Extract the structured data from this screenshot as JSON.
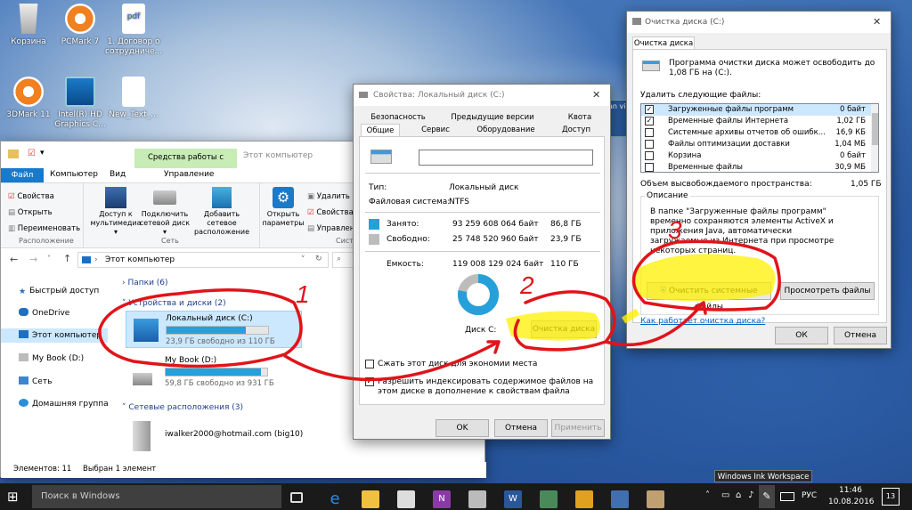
{
  "desktop": {
    "icons": [
      {
        "label": "Корзина"
      },
      {
        "label": "PCMark 7"
      },
      {
        "label": "1. Договор о сотрудниче..."
      },
      {
        "label": "3DMark 11"
      },
      {
        "label": "Intel(R) HD Graphics C..."
      },
      {
        "label": "New_Text_..."
      }
    ]
  },
  "explorer": {
    "title": "Этот компьютер",
    "ribbon_context": "Средства работы с дисками",
    "tabs": [
      "Файл",
      "Компьютер",
      "Вид",
      "Управление"
    ],
    "group_location": {
      "items": [
        "Свойства",
        "Открыть",
        "Переименовать"
      ],
      "label": "Расположение"
    },
    "group_network": {
      "items": [
        "Доступ к мультимедиа ▾",
        "Подключить сетевой диск ▾",
        "Добавить сетевое расположение"
      ],
      "label": "Сеть"
    },
    "group_system": {
      "items": [
        "Открыть параметры",
        "Удалить и",
        "Свойства с",
        "Управлен"
      ],
      "label": "Систе"
    },
    "address": "Этот компьютер",
    "nav": [
      "Быстрый доступ",
      "OneDrive",
      "Этот компьютер",
      "My Book (D:)",
      "Сеть",
      "Домашняя группа"
    ],
    "section_folders": "Папки (6)",
    "section_drives": "Устройства и диски (2)",
    "drive_c": {
      "name": "Локальный диск (C:)",
      "free": "23,9 ГБ свободно из 110 ГБ",
      "used_fraction": 0.78
    },
    "drive_d": {
      "name": "My Book (D:)",
      "free": "59,8 ГБ свободно из 931 ГБ",
      "used_fraction": 0.94
    },
    "section_network": "Сетевые расположения (3)",
    "network_item": "iwalker2000@hotmail.com (big10)",
    "status_items": "Элементов: 11",
    "status_selected": "Выбран 1 элемент"
  },
  "props": {
    "title": "Свойства: Локальный диск (C:)",
    "tabs_row1": [
      "Безопасность",
      "Предыдущие версии",
      "Квота"
    ],
    "tabs_row2": [
      "Общие",
      "Сервис",
      "Оборудование",
      "Доступ"
    ],
    "type_label": "Тип:",
    "type_value": "Локальный диск",
    "fs_label": "Файловая система:",
    "fs_value": "NTFS",
    "used_label": "Занято:",
    "used_bytes": "93 259 608 064 байт",
    "used_gb": "86,8 ГБ",
    "free_label": "Свободно:",
    "free_bytes": "25 748 520 960 байт",
    "free_gb": "23,9 ГБ",
    "cap_label": "Емкость:",
    "cap_bytes": "119 008 129 024 байт",
    "cap_gb": "110 ГБ",
    "disk_label": "Диск C:",
    "cleanup_button": "Очистка диска",
    "compress_label": "Сжать этот диск для экономии места",
    "index_label": "Разрешить индексировать содержимое файлов на этом диске в дополнение к свойствам файла",
    "ok": "OK",
    "cancel": "Отмена",
    "apply": "Применить",
    "used_color": "#26a0da",
    "free_color": "#bcbcbc",
    "used_fraction": 0.784
  },
  "cleanup": {
    "title": "Очистка диска  (C:)",
    "tab": "Очистка диска",
    "intro": "Программа очистки диска может освободить до 1,08 ГБ на  (C:).",
    "list_label": "Удалить следующие файлы:",
    "files": [
      {
        "name": "Загруженные файлы программ",
        "size": "0 байт",
        "checked": true
      },
      {
        "name": "Временные файлы Интернета",
        "size": "1,02 ГБ",
        "checked": true
      },
      {
        "name": "Системные архивы отчетов об ошибк...",
        "size": "16,9 КБ",
        "checked": false
      },
      {
        "name": "Файлы оптимизации доставки",
        "size": "1,04 МБ",
        "checked": false
      },
      {
        "name": "Корзина",
        "size": "0 байт",
        "checked": false
      },
      {
        "name": "Временные файлы",
        "size": "30,9 МБ",
        "checked": false
      }
    ],
    "total_label": "Объем высвобождаемого пространства:",
    "total_value": "1,05 ГБ",
    "desc_label": "Описание",
    "desc_text": "В папке \"Загруженные файлы программ\" временно сохраняются элементы ActiveX и приложения Java, автоматически загружаемые из Интернета при просмотре некоторых страниц.",
    "sys_button": "Очистить системные файлы",
    "view_button": "Просмотреть файлы",
    "link": "Как работает очистка диска?",
    "ok": "ОК",
    "cancel": "Отмена"
  },
  "annotations": [
    "1",
    "2",
    "3"
  ],
  "ink_tooltip": "Windows Ink Workspace",
  "taskbar": {
    "search": "Поиск в Windows",
    "lang": "РУС",
    "time": "11:46",
    "date": "10.08.2016",
    "notif": "13"
  },
  "bg_partial": "an vie"
}
